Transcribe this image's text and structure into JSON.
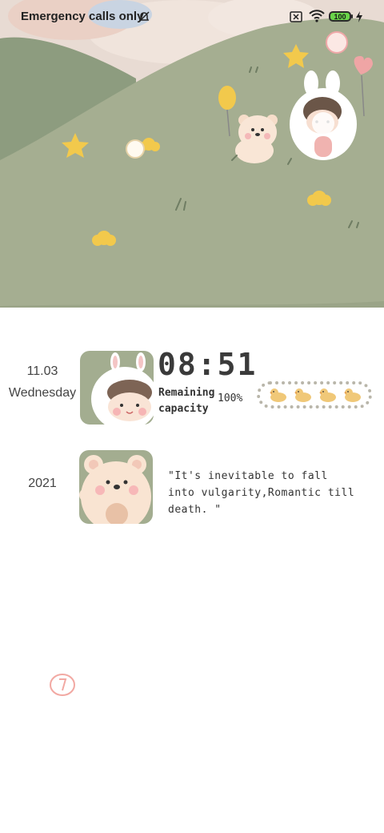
{
  "status_bar": {
    "carrier": "Emergency calls only",
    "battery_level": "100",
    "icons": [
      "mute-bell-icon",
      "no-sim-icon",
      "wifi-icon",
      "battery-icon",
      "charging-icon"
    ]
  },
  "wallpaper": {
    "description_icons": [
      "bunny-girl-icon",
      "bear-with-balloon-icon",
      "heart-balloon-icon",
      "star-icon",
      "flower-icon"
    ],
    "colors": {
      "sky": "#e7d9d1",
      "hill_dark": "#8b9a7d",
      "meadow": "#a4ad90"
    }
  },
  "widgets": {
    "date_md": "11.03",
    "weekday": "Wednesday",
    "year": "2021",
    "clock": "08:51",
    "remaining_label": "Remaining capacity",
    "remaining_value": "100%",
    "quote": "\"It's inevitable to fall into vulgarity,Romantic till death. \""
  }
}
